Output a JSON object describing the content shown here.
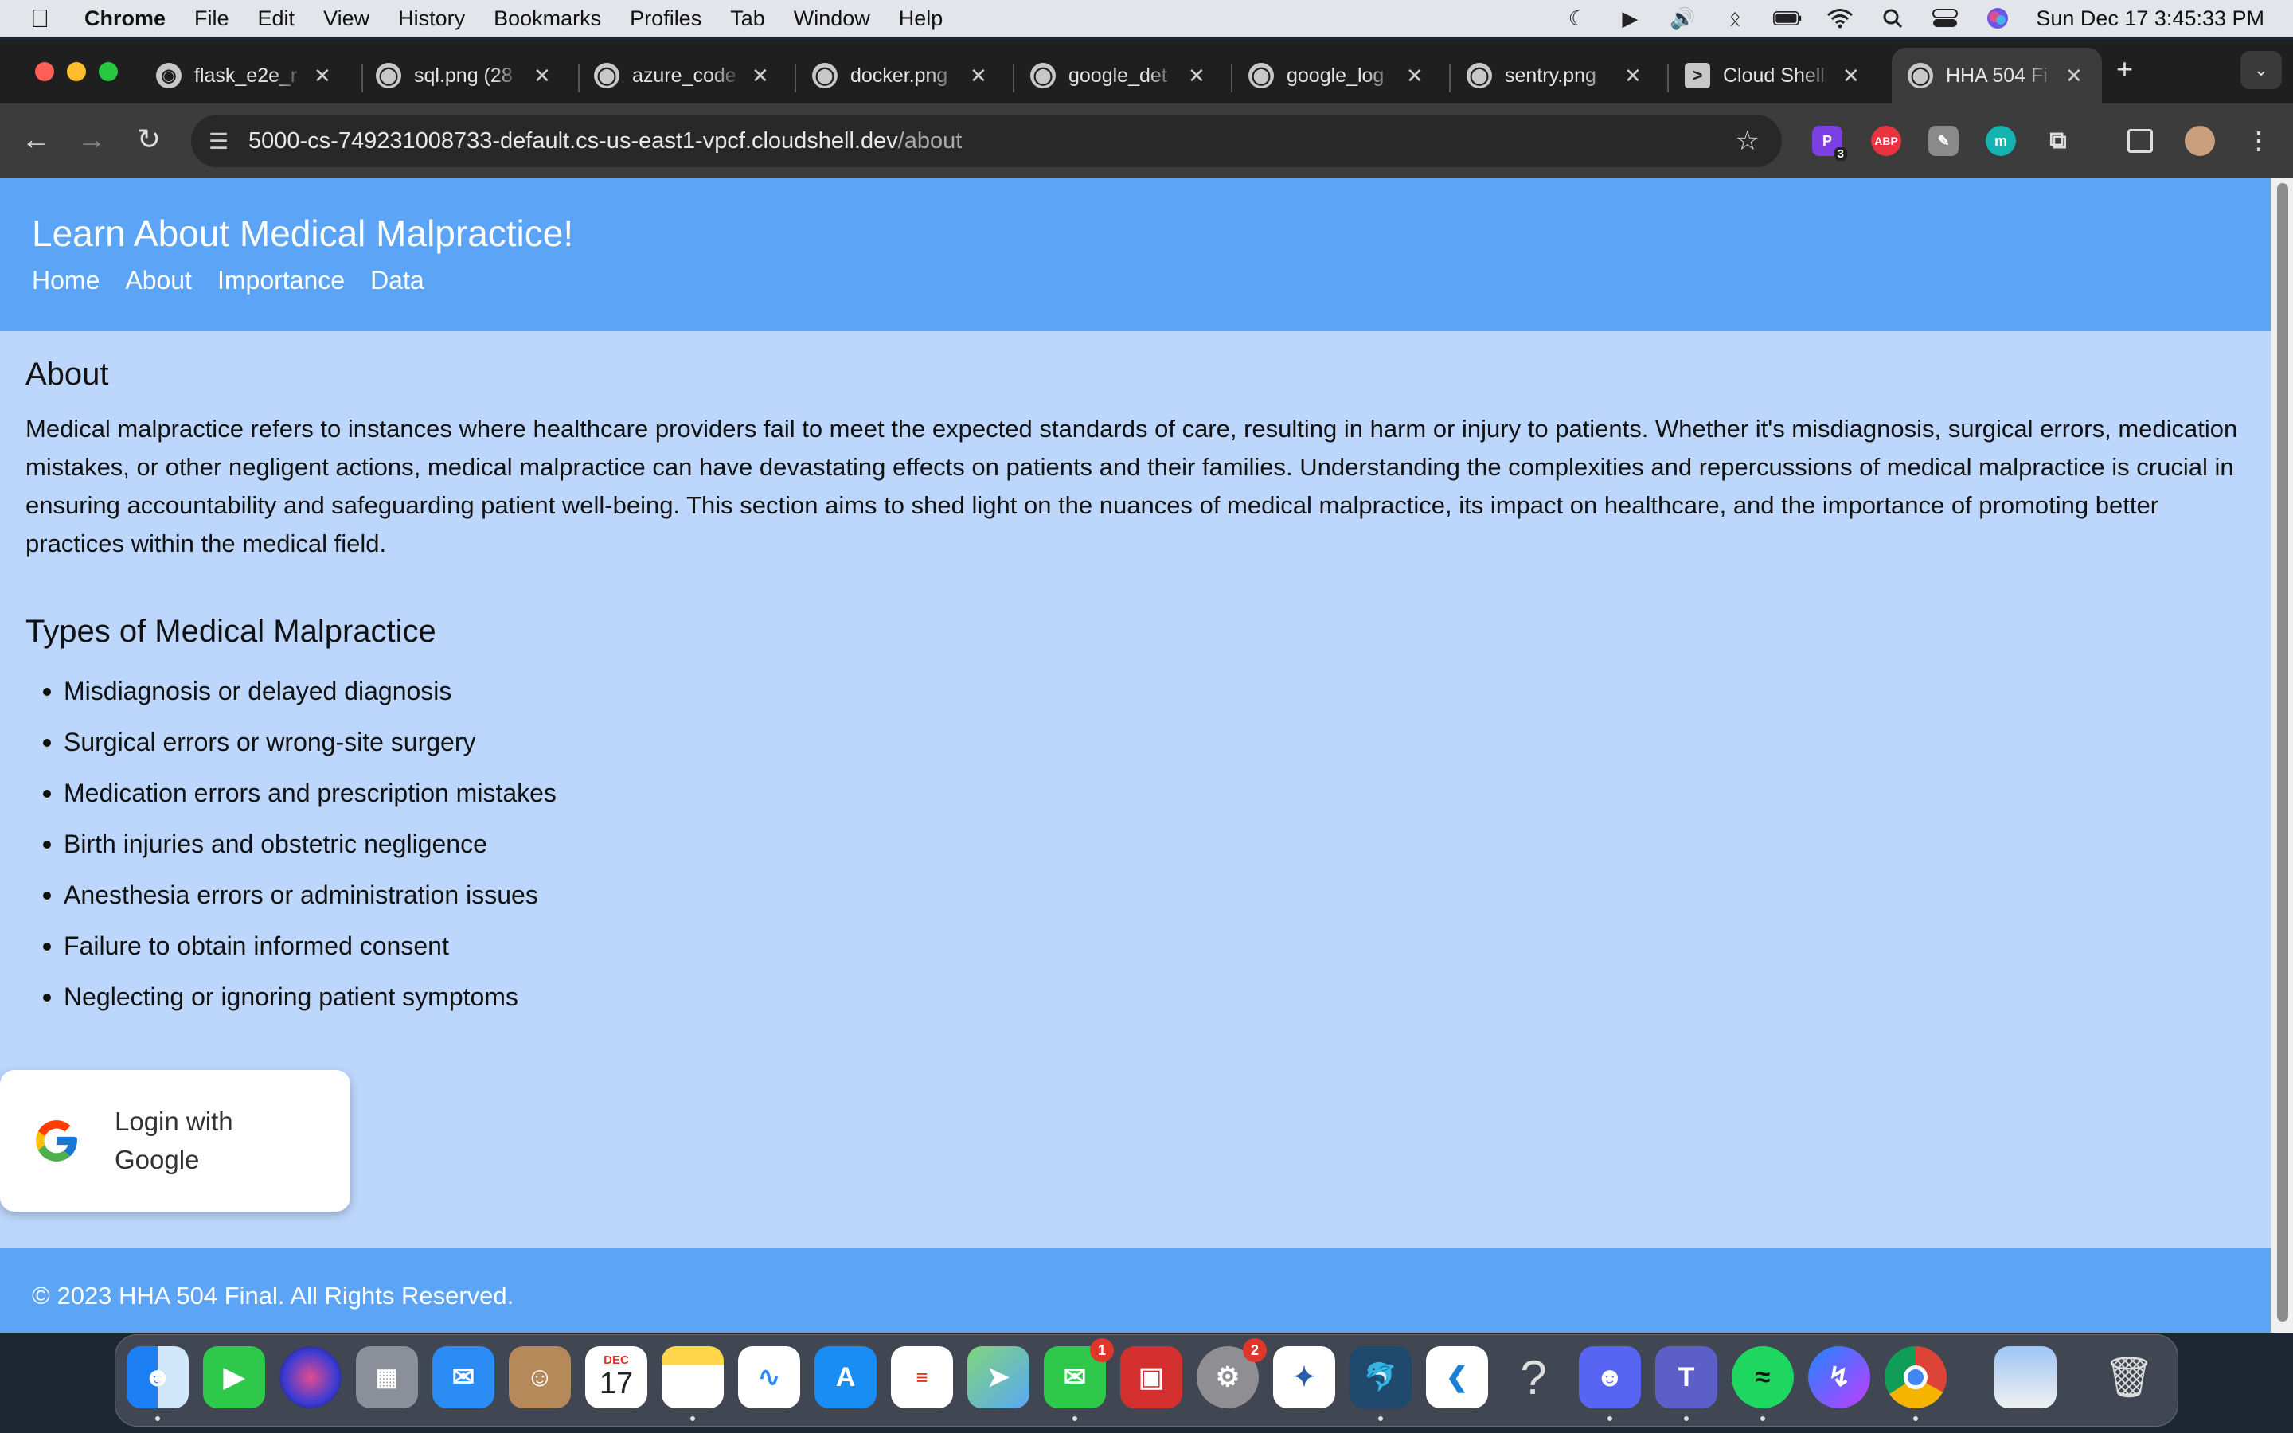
{
  "menubar": {
    "app": "Chrome",
    "items": [
      "File",
      "Edit",
      "View",
      "History",
      "Bookmarks",
      "Profiles",
      "Tab",
      "Window",
      "Help"
    ],
    "status_icons": [
      "moon-icon",
      "play-circle-icon",
      "volume-icon",
      "bluetooth-icon",
      "battery-icon",
      "wifi-icon",
      "spotlight-icon",
      "control-center-icon",
      "siri-icon"
    ],
    "clock": "Sun Dec 17  3:45:33 PM"
  },
  "tabs": [
    {
      "title": "flask_e2e_r",
      "icon": "github-icon"
    },
    {
      "title": "sql.png (28",
      "icon": "globe-icon"
    },
    {
      "title": "azure_code",
      "icon": "globe-icon"
    },
    {
      "title": "docker.png",
      "icon": "globe-icon"
    },
    {
      "title": "google_det",
      "icon": "globe-icon"
    },
    {
      "title": "google_log",
      "icon": "globe-icon"
    },
    {
      "title": "sentry.png",
      "icon": "globe-icon"
    },
    {
      "title": "Cloud Shell",
      "icon": "terminal-icon"
    },
    {
      "title": "HHA 504 Fi",
      "icon": "globe-icon",
      "active": true
    }
  ],
  "toolbar": {
    "url_host": "5000-cs-749231008733-default.cs-us-east1-vpcf.cloudshell.dev",
    "url_path": "/about",
    "extension_badge": "3",
    "abp_label": "ABP"
  },
  "site": {
    "title": "Learn About Medical Malpractice!",
    "nav": [
      "Home",
      "About",
      "Importance",
      "Data"
    ],
    "about_heading": "About",
    "about_body": "Medical malpractice refers to instances where healthcare providers fail to meet the expected standards of care, resulting in harm or injury to patients. Whether it's misdiagnosis, surgical errors, medication mistakes, or other negligent actions, medical malpractice can have devastating effects on patients and their families. Understanding the complexities and repercussions of medical malpractice is crucial in ensuring accountability and safeguarding patient well-being. This section aims to shed light on the nuances of medical malpractice, its impact on healthcare, and the importance of promoting better practices within the medical field.",
    "types_heading": "Types of Medical Malpractice",
    "types": [
      "Misdiagnosis or delayed diagnosis",
      "Surgical errors or wrong-site surgery",
      "Medication errors and prescription mistakes",
      "Birth injuries and obstetric negligence",
      "Anesthesia errors or administration issues",
      "Failure to obtain informed consent",
      "Neglecting or ignoring patient symptoms"
    ],
    "login_label": "Login with Google",
    "footer": "© 2023 HHA 504 Final. All Rights Reserved."
  },
  "dock": {
    "calendar_month": "DEC",
    "calendar_day": "17",
    "messages_badge": "1",
    "settings_badge": "2"
  },
  "colors": {
    "header": "#5ba4f6",
    "page_bg": "#bdd7fc",
    "tab_bar": "#1f1f1f",
    "toolbar": "#3c3c3c"
  }
}
